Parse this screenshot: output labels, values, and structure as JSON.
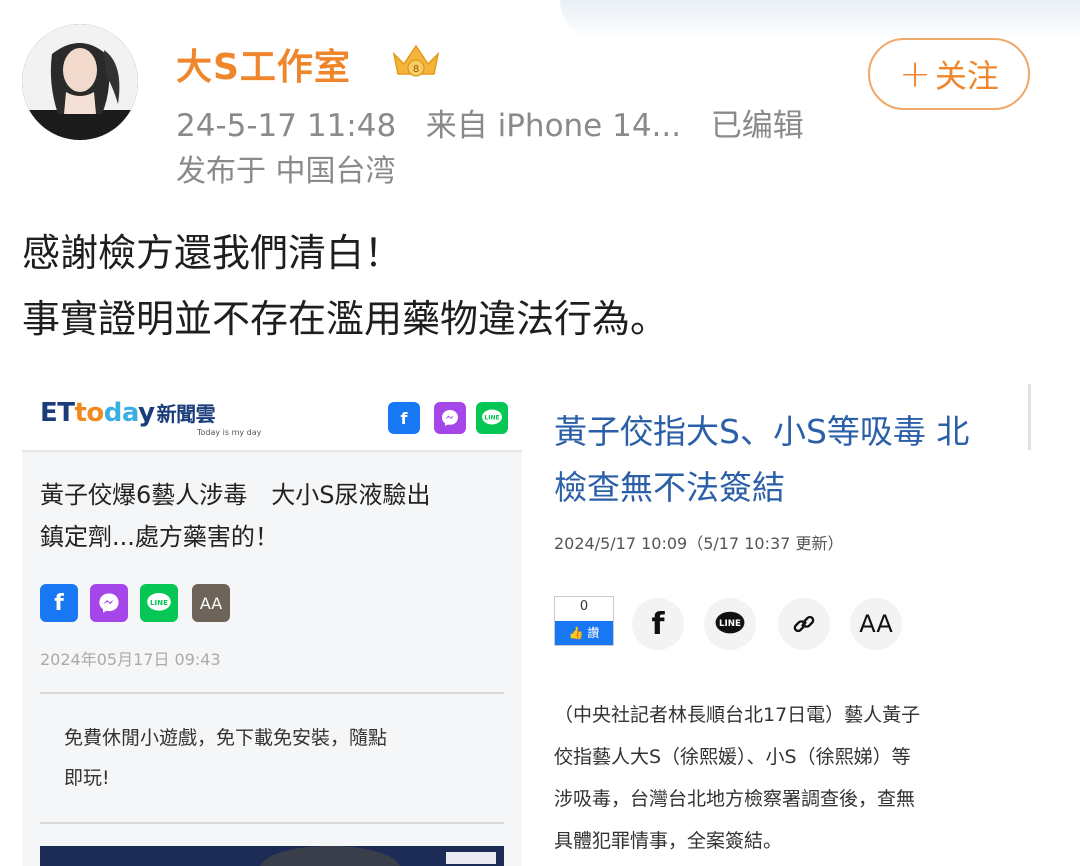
{
  "post": {
    "username": "大S工作室",
    "meta_time": "24-5-17 11:48",
    "meta_source": "来自 iPhone 14...",
    "meta_edited": "已编辑",
    "meta_location": "发布于 中国台湾",
    "follow_label": "关注",
    "text_line1": "感謝檢方還我們清白！",
    "text_line2": "事實證明並不存在濫用藥物違法行為。"
  },
  "left_card": {
    "logo_et": "ET",
    "logo_to": "to",
    "logo_da": "da",
    "logo_y": "y",
    "logo_zh": "新聞雲",
    "logo_sub": "Today is my day",
    "headline_line1": "黃子佼爆6藝人涉毒　大小S尿液驗出",
    "headline_line2": "鎮定劑...處方藥害的！",
    "text_size_label": "AA",
    "date": "2024年05月17日 09:43",
    "ad_line1": "免費休閒小遊戲，免下載免安裝，隨點",
    "ad_line2": "即玩!"
  },
  "right_card": {
    "title_line1": "黃子佼指大S、小S等吸毒 北",
    "title_line2": "檢查無不法簽結",
    "date": "2024/5/17 10:09（5/17 10:37 更新）",
    "like_count": "0",
    "like_label": "讚",
    "text_size_label": "AA",
    "body_line1": "（中央社記者林長順台北17日電）藝人黃子",
    "body_line2": "佼指藝人大S（徐熙媛）、小S（徐熙娣）等",
    "body_line3": "涉吸毒，台灣台北地方檢察署調查後，查無",
    "body_line4": "具體犯罪情事，全案簽結。"
  },
  "colors": {
    "username": "#f0862c",
    "follow_border": "#f0a86a",
    "title_blue": "#2b5fa8",
    "facebook": "#1877f2",
    "line": "#06c755",
    "messenger": "#a446e8"
  }
}
